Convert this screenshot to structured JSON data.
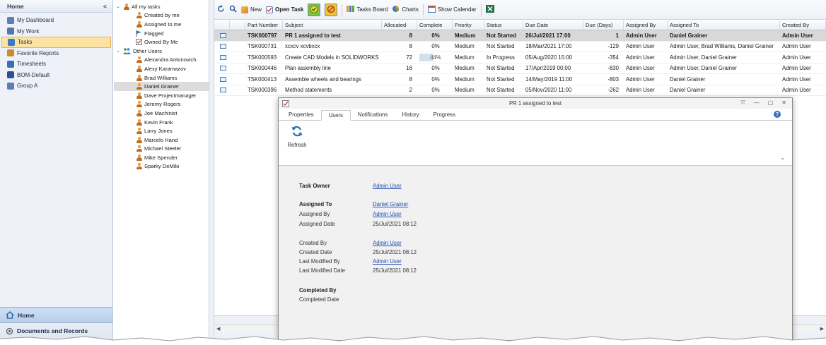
{
  "nav": {
    "title": "Home",
    "collapse_glyph": "<",
    "items": [
      {
        "label": "My Dashboard",
        "icon": "dashboard-icon",
        "color": "#5a7fb8",
        "active": false
      },
      {
        "label": "My Work",
        "icon": "work-icon",
        "color": "#4d79b5",
        "active": false
      },
      {
        "label": "Tasks",
        "icon": "tasks-icon",
        "color": "#3c7bc4",
        "active": true
      },
      {
        "label": "Favorite Reports",
        "icon": "reports-icon",
        "color": "#d08a28",
        "active": false
      },
      {
        "label": "Timesheets",
        "icon": "timesheets-icon",
        "color": "#3a6fb6",
        "active": false
      },
      {
        "label": "BOM-Default",
        "icon": "bom-icon",
        "color": "#2e4f8f",
        "active": false
      },
      {
        "label": "Group A",
        "icon": "group-icon",
        "color": "#5a7fb8",
        "active": false
      }
    ],
    "bottom": {
      "home": "Home",
      "documents": "Documents and Records"
    }
  },
  "tree": {
    "root": "All my tasks",
    "my_items": [
      "Created by me",
      "Assigned to me",
      "Flagged",
      "Owned By Me"
    ],
    "others_label": "Other Users",
    "users": [
      "Alexandra Antonovich",
      "Alexy Karamazov",
      "Brad Williams",
      "Daniel Grainer",
      "Dave Projectmanager",
      "Jeremy Rogers",
      "Joe Machinist",
      "Kevin Frank",
      "Larry Jones",
      "Marcelo Hand",
      "Michael Steeler",
      "Mike Spender",
      "Sparky DeMilo"
    ],
    "selected_user": "Daniel Grainer"
  },
  "toolbar": {
    "new_label": "New",
    "open_task_label": "Open Task",
    "tasks_board_label": "Tasks Board",
    "charts_label": "Charts",
    "show_calendar_label": "Show Calendar"
  },
  "grid": {
    "columns": [
      "Part Number",
      "Subject",
      "Allocated",
      "Complete",
      "Priority",
      "Status",
      "Due Date",
      "Due (Days)",
      "Assigned By",
      "Assigned To",
      "Created By"
    ],
    "rows": [
      {
        "part": "TSK000797",
        "subject": "PR 1 assigned to test",
        "allocated": "8",
        "complete": "0%",
        "complete_fraction": 0,
        "priority": "Medium",
        "status": "Not Started",
        "due_date": "26/Jul/2021 17:00",
        "due_days": "1",
        "assigned_by": "Admin User",
        "assigned_to": "Daniel Grainer",
        "created_by": "Admin User"
      },
      {
        "part": "TSK000731",
        "subject": "xcxcv xcvbxcx",
        "allocated": "8",
        "complete": "0%",
        "complete_fraction": 0,
        "priority": "Medium",
        "status": "Not Started",
        "due_date": "18/Mar/2021 17:00",
        "due_days": "-129",
        "assigned_by": "Admin User",
        "assigned_to": "Admin User, Brad Williams, Daniel Grainer",
        "created_by": "Admin User"
      },
      {
        "part": "TSK000593",
        "subject": "Create CAD Models in SOLIDWORKS",
        "allocated": "72",
        "complete": "44%",
        "complete_fraction": 0.44,
        "priority": "Medium",
        "status": "In Progress",
        "due_date": "05/Aug/2020 15:00",
        "due_days": "-354",
        "assigned_by": "Admin User",
        "assigned_to": "Admin User, Daniel Grainer",
        "created_by": "Admin User"
      },
      {
        "part": "TSK000446",
        "subject": "Plan assembly line",
        "allocated": "16",
        "complete": "0%",
        "complete_fraction": 0,
        "priority": "Medium",
        "status": "Not Started",
        "due_date": "17/Apr/2019 00:00",
        "due_days": "-830",
        "assigned_by": "Admin User",
        "assigned_to": "Admin User, Daniel Grainer",
        "created_by": "Admin User"
      },
      {
        "part": "TSK000413",
        "subject": "Assemble wheels and bearings",
        "allocated": "8",
        "complete": "0%",
        "complete_fraction": 0,
        "priority": "Medium",
        "status": "Not Started",
        "due_date": "14/May/2019 11:00",
        "due_days": "-803",
        "assigned_by": "Admin User",
        "assigned_to": "Daniel Grainer",
        "created_by": "Admin User"
      },
      {
        "part": "TSK000396",
        "subject": "Method statements",
        "allocated": "2",
        "complete": "0%",
        "complete_fraction": 0,
        "priority": "Medium",
        "status": "Not Started",
        "due_date": "05/Nov/2020 11:00",
        "due_days": "-262",
        "assigned_by": "Admin User",
        "assigned_to": "Daniel Grainer",
        "created_by": "Admin User"
      }
    ]
  },
  "dialog": {
    "title": "PR 1 assigned to test",
    "tabs": [
      "Properties",
      "Users",
      "Notifications",
      "History",
      "Progress"
    ],
    "selected_tab": "Users",
    "refresh_label": "Refresh",
    "fields": {
      "task_owner_label": "Task Owner",
      "task_owner": "Admin User",
      "assigned_to_label": "Assigned To",
      "assigned_to": "Daniel Grainer",
      "assigned_by_label": "Assigned By",
      "assigned_by": "Admin User",
      "assigned_date_label": "Assigned Date",
      "assigned_date": "25/Jul/2021 08:12",
      "created_by_label": "Created By",
      "created_by": "Admin User",
      "created_date_label": "Created Date",
      "created_date": "25/Jul/2021 08:12",
      "last_modified_by_label": "Last Modified By",
      "last_modified_by": "Admin User",
      "last_modified_date_label": "Last Modified Date",
      "last_modified_date": "25/Jul/2021 08:12",
      "completed_by_label": "Completed By",
      "completed_date_label": "Completed Date"
    }
  },
  "colors": {
    "accent": "#3c7bc4",
    "active_nav": "#fde3a1",
    "link": "#1f4fb0"
  }
}
